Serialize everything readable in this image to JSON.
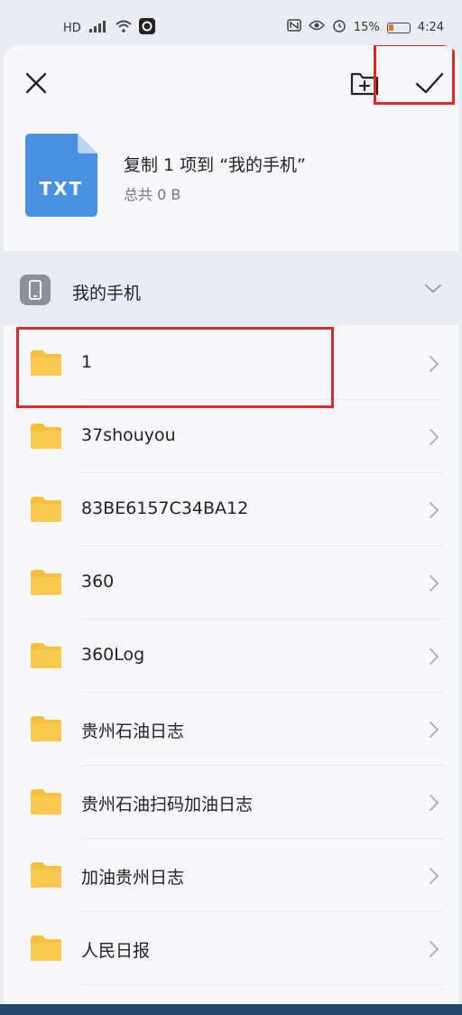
{
  "status_bar": {
    "left_icons": [
      "hd-icon",
      "signal-icon",
      "wifi-icon",
      "app-icon"
    ],
    "battery_percent": "15%",
    "time": "4:24"
  },
  "toolbar": {
    "close_label": "close",
    "new_folder_label": "new folder",
    "confirm_label": "confirm"
  },
  "summary": {
    "file_type": "TXT",
    "title": "复制 1 项到 “我的手机”",
    "subtitle": "总共 0 B"
  },
  "location": {
    "label": "我的手机"
  },
  "folders": [
    {
      "name": "1"
    },
    {
      "name": "37shouyou"
    },
    {
      "name": "83BE6157C34BA12"
    },
    {
      "name": "360"
    },
    {
      "name": "360Log"
    },
    {
      "name": "贵州石油日志"
    },
    {
      "name": "贵州石油扫码加油日志"
    },
    {
      "name": "加油贵州日志"
    },
    {
      "name": "人民日报"
    }
  ],
  "colors": {
    "highlight": "#e0282b",
    "folder": "#f7bf3e",
    "txt_file": "#4a90e2"
  }
}
